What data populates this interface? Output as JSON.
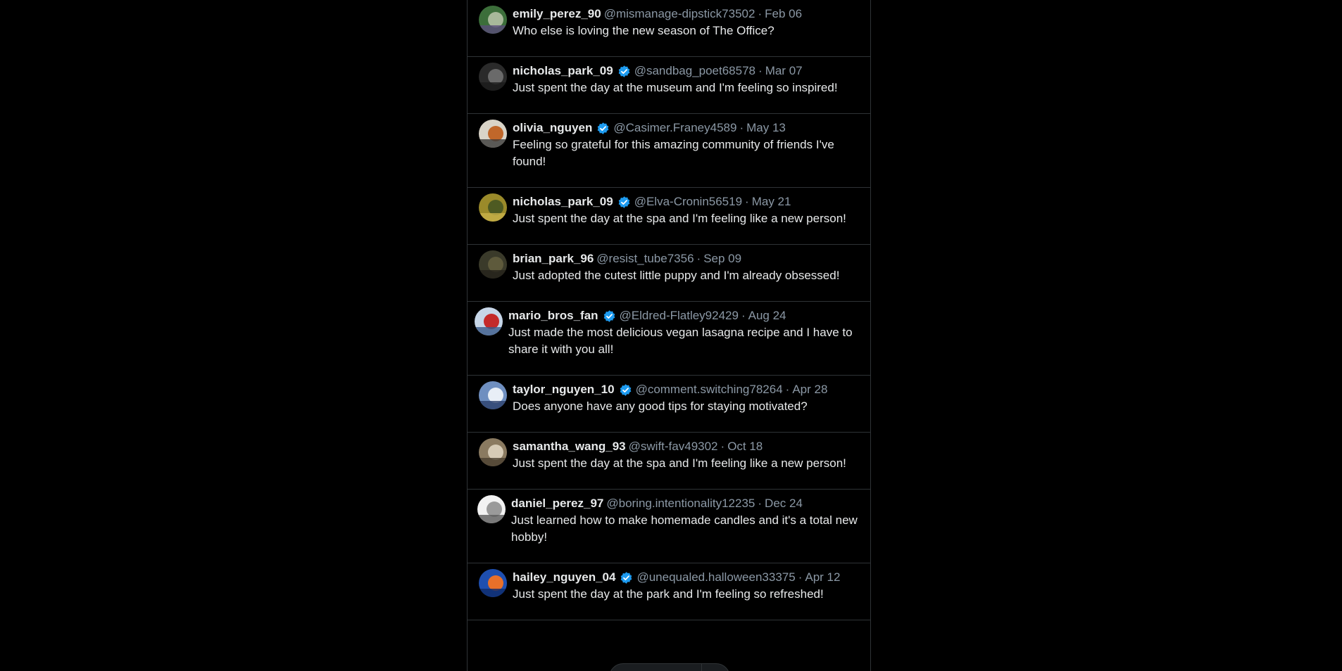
{
  "colors": {
    "background": "#000000",
    "text": "#e7e9ea",
    "muted": "#8b98a5",
    "border": "#2f3336",
    "verified": "#1d9bf0"
  },
  "separator": "·",
  "posts": [
    {
      "name": "emily_perez_90",
      "verified": false,
      "handle": "@mismanage-dipstick73502",
      "date": "Feb 06",
      "text": "Who else is loving the new season of The Office?",
      "avatar_icon": "avatar-photo",
      "avatar_colors": [
        "#3c6e3a",
        "#a8b89a",
        "#5a4c7a"
      ]
    },
    {
      "name": "nicholas_park_09",
      "verified": true,
      "handle": "@sandbag_poet68578",
      "date": "Mar 07",
      "text": "Just spent the day at the museum and I'm feeling so inspired!",
      "avatar_icon": "avatar-photo",
      "avatar_colors": [
        "#2a2a2a",
        "#6a6a6a",
        "#1a1a1a"
      ]
    },
    {
      "name": "olivia_nguyen",
      "verified": true,
      "handle": "@Casimer.Franey4589",
      "date": "May 13",
      "text": "Feeling so grateful for this amazing community of friends I've found!",
      "avatar_icon": "avatar-photo",
      "avatar_colors": [
        "#d9d4c8",
        "#c0672a",
        "#3a3a3a"
      ]
    },
    {
      "name": "nicholas_park_09",
      "verified": true,
      "handle": "@Elva-Cronin56519",
      "date": "May 21",
      "text": "Just spent the day at the spa and I'm feeling like a new person!",
      "avatar_icon": "avatar-photo",
      "avatar_colors": [
        "#9a8a2a",
        "#4e5a22",
        "#c9b24a"
      ]
    },
    {
      "name": "brian_park_96",
      "verified": false,
      "handle": "@resist_tube7356",
      "date": "Sep 09",
      "text": "Just adopted the cutest little puppy and I'm already obsessed!",
      "avatar_icon": "avatar-photo",
      "avatar_colors": [
        "#3a3a2a",
        "#5e5a3c",
        "#24221a"
      ]
    },
    {
      "name": "mario_bros_fan",
      "verified": true,
      "handle": "@Eldred-Flatley92429",
      "date": "Aug 24",
      "text": "Just made the most delicious vegan lasagna recipe and I have to share it with you all!",
      "avatar_icon": "avatar-photo",
      "avatar_colors": [
        "#c7d6e8",
        "#c42a2a",
        "#3a5a8a"
      ]
    },
    {
      "name": "taylor_nguyen_10",
      "verified": true,
      "handle": "@comment.switching78264",
      "date": "Apr 28",
      "text": "Does anyone have any good tips for staying motivated?",
      "avatar_icon": "avatar-photo",
      "avatar_colors": [
        "#6f8fc0",
        "#e8eef6",
        "#2a3e6a"
      ]
    },
    {
      "name": "samantha_wang_93",
      "verified": false,
      "handle": "@swift-fav49302",
      "date": "Oct 18",
      "text": "Just spent the day at the spa and I'm feeling like a new person!",
      "avatar_icon": "avatar-photo",
      "avatar_colors": [
        "#8a7a60",
        "#d6cbb6",
        "#4a4030"
      ]
    },
    {
      "name": "daniel_perez_97",
      "verified": false,
      "handle": "@boring.intentionality12235",
      "date": "Dec 24",
      "text": "Just learned how to make homemade candles and it's a total new hobby!",
      "avatar_icon": "avatar-photo",
      "avatar_colors": [
        "#f2f2f2",
        "#9a9a9a",
        "#5a5a5a"
      ]
    },
    {
      "name": "hailey_nguyen_04",
      "verified": true,
      "handle": "@unequaled.halloween33375",
      "date": "Apr 12",
      "text": "Just spent the day at the park and I'm feeling so refreshed!",
      "avatar_icon": "avatar-photo",
      "avatar_colors": [
        "#1e4fb0",
        "#e8702a",
        "#0e2a6a"
      ]
    }
  ]
}
